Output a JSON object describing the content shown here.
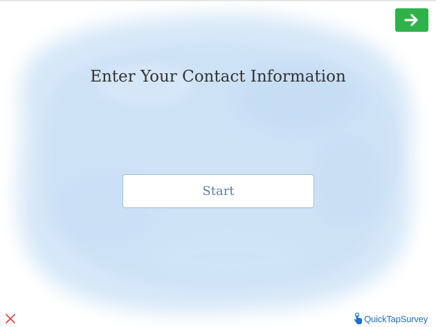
{
  "survey": {
    "title": "Enter Your Contact Information",
    "start_label": "Start"
  },
  "navigation": {
    "next_icon": "arrow-right-icon",
    "close_icon": "close-x-icon"
  },
  "branding": {
    "name": "QuickTapSurvey",
    "icon": "tap-hand-icon"
  },
  "colors": {
    "next_button": "#2fb24a",
    "brand": "#1e6fc6",
    "close": "#e0403a",
    "watercolor": "#cfe3f7"
  }
}
